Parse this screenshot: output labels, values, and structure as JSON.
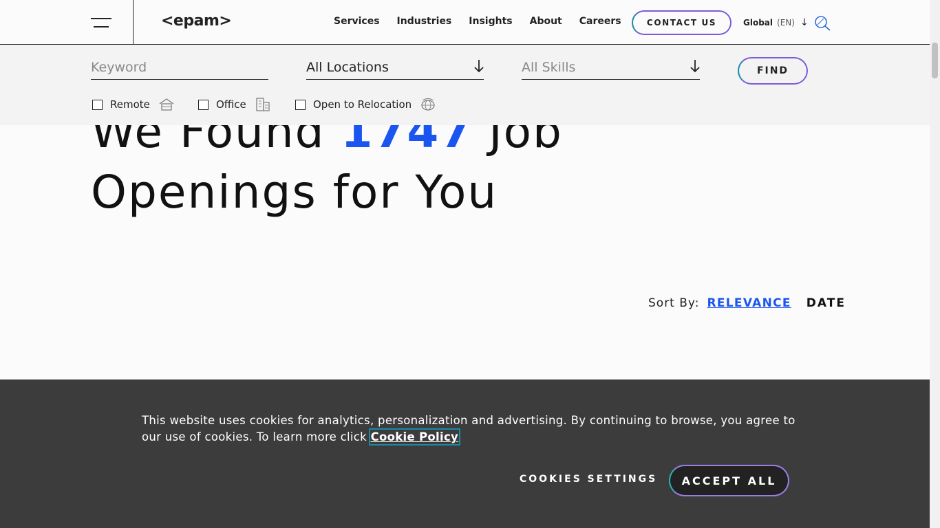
{
  "header": {
    "logo": "<epam>",
    "nav": [
      "Services",
      "Industries",
      "Insights",
      "About",
      "Careers"
    ],
    "contact_label": "CONTACT US",
    "global_label": "Global",
    "global_code": "(EN)"
  },
  "filters": {
    "keyword_placeholder": "Keyword",
    "location_value": "All Locations",
    "skills_placeholder": "All Skills",
    "find_label": "FIND",
    "checkboxes": [
      {
        "label": "Remote",
        "checked": false,
        "icon": "house-icon"
      },
      {
        "label": "Office",
        "checked": false,
        "icon": "building-icon"
      },
      {
        "label": "Open to Relocation",
        "checked": false,
        "icon": "globe-icon"
      }
    ]
  },
  "heading": {
    "prefix": "We Found",
    "count": "1747",
    "suffix": "Job",
    "line2": "Openings for You"
  },
  "sort": {
    "label": "Sort By:",
    "relevance": "RELEVANCE",
    "date": "DATE",
    "active": "RELEVANCE"
  },
  "cookie": {
    "message": "This website uses cookies for analytics, personalization and advertising. By continuing to browse, you agree to our use of cookies. To learn more click ",
    "policy_link": "Cookie Policy",
    "settings_label": "COOKIES SETTINGS",
    "accept_label": "ACCEPT ALL"
  },
  "colors": {
    "accent_blue": "#1a55f0",
    "gradient_teal": "#1a8aa8",
    "gradient_purple": "#7c5cd6",
    "banner_bg": "#343434"
  }
}
